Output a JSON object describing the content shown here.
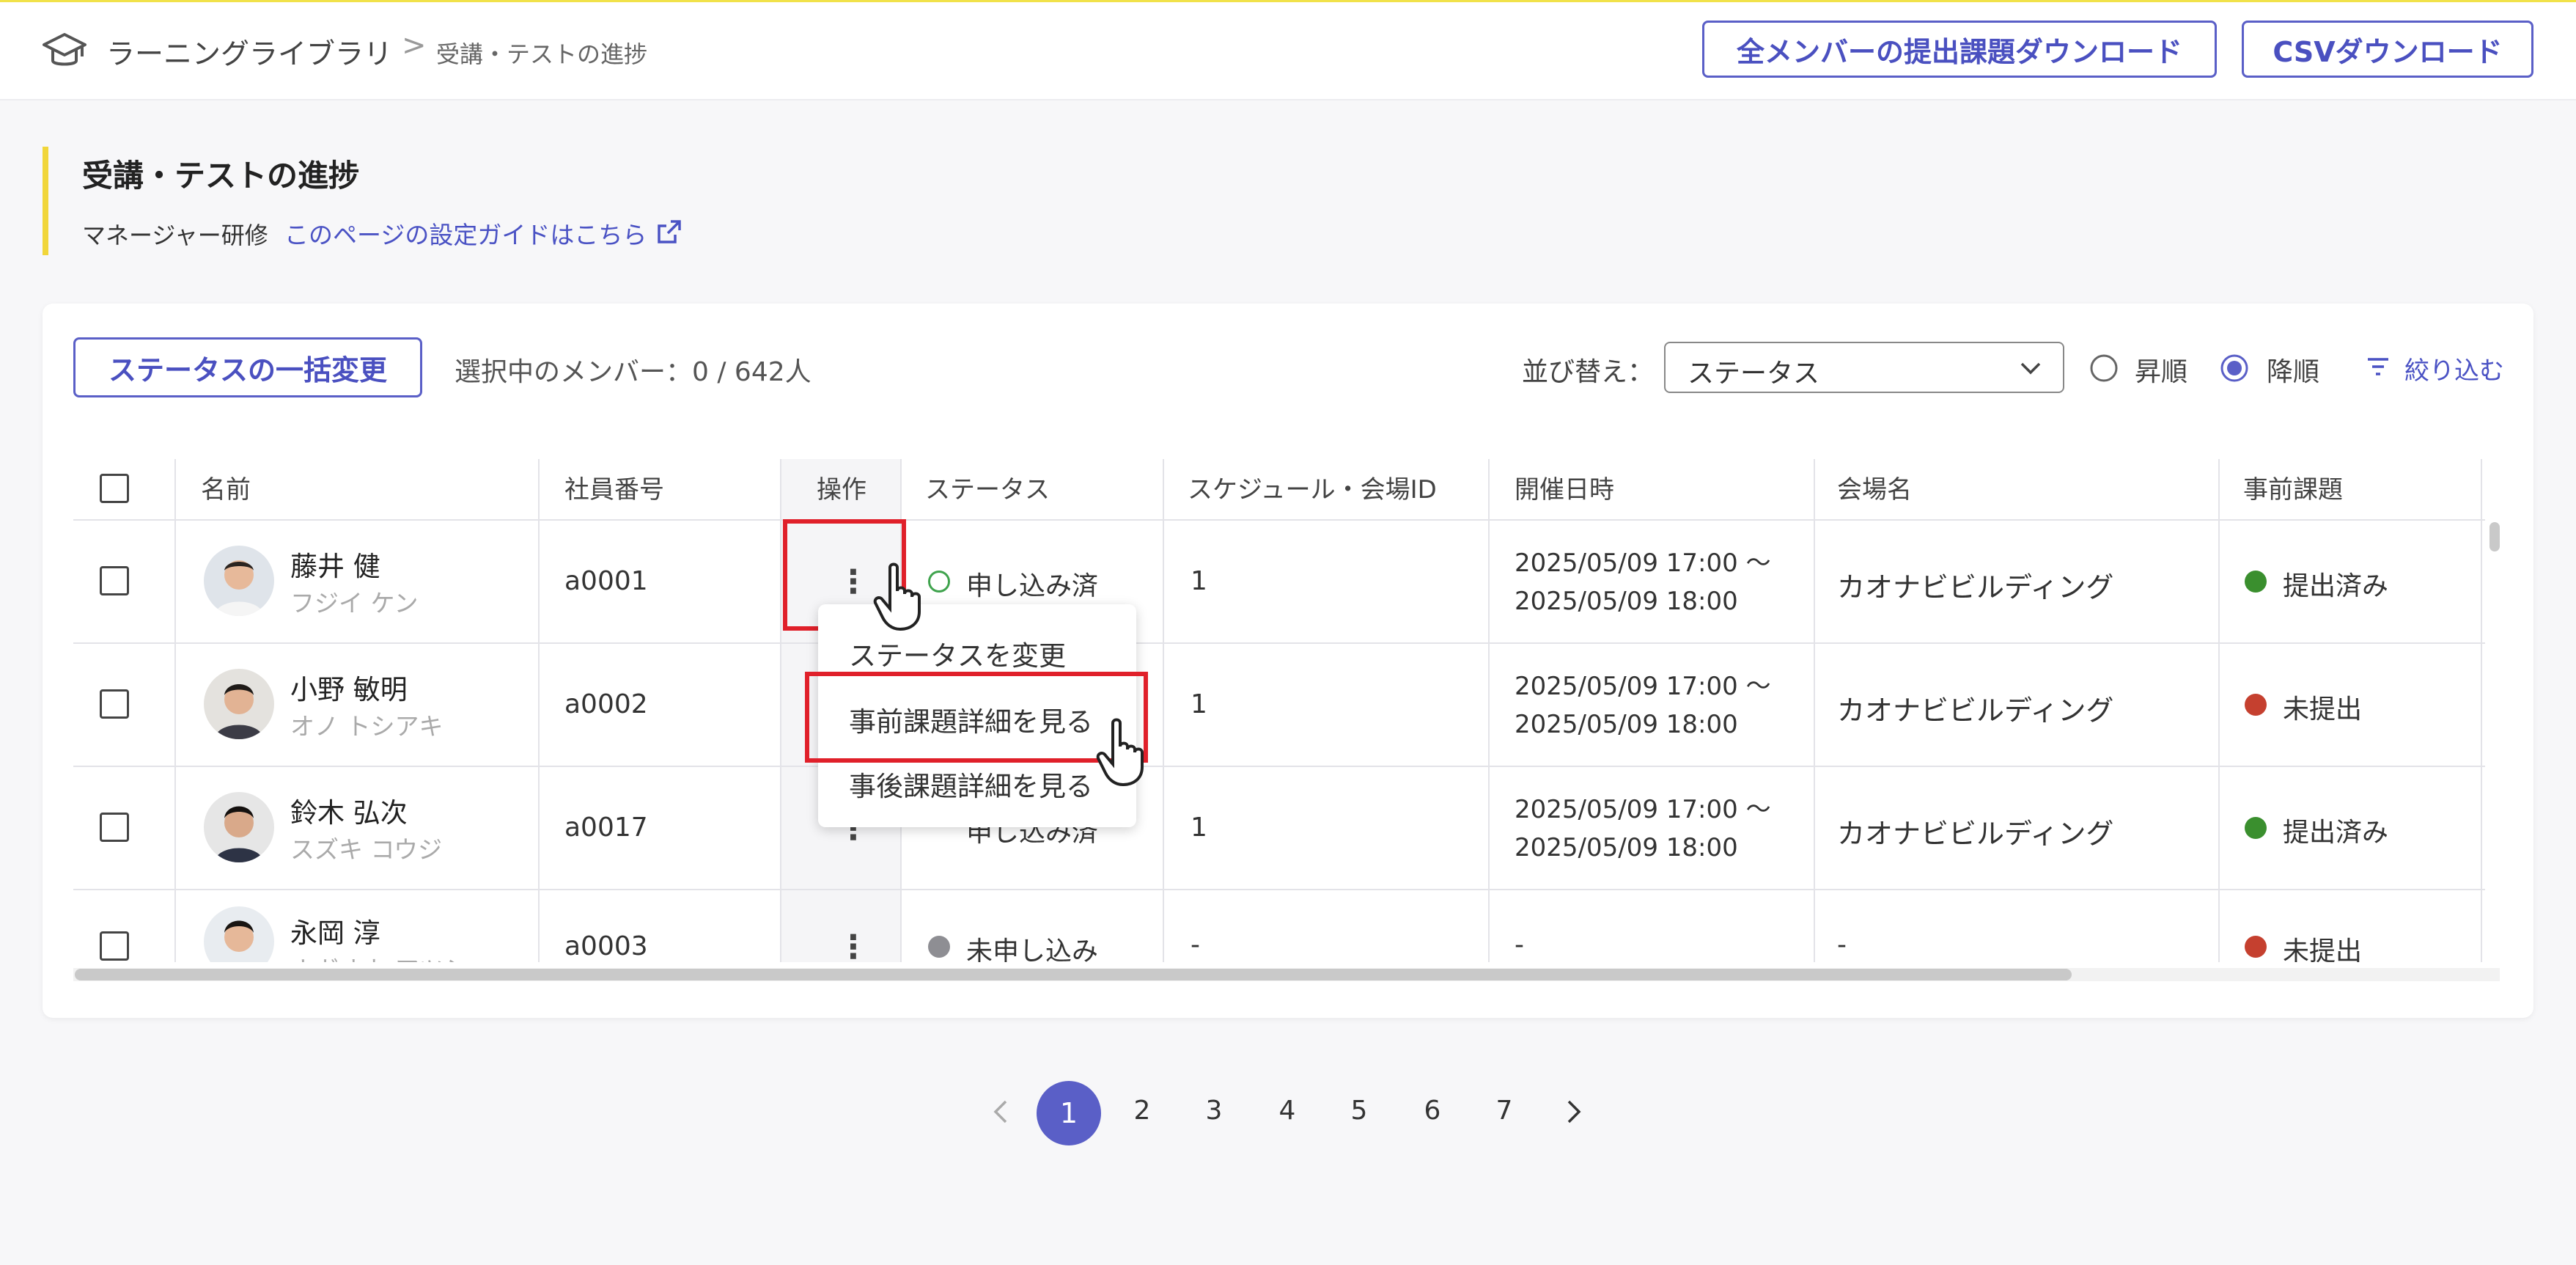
{
  "header": {
    "breadcrumb_root": "ラーニングライブラリ",
    "breadcrumb_sep": ">",
    "breadcrumb_current": "受講・テストの進捗",
    "download_all_label": "全メンバーの提出課題ダウンロード",
    "csv_label": "CSVダウンロード"
  },
  "page": {
    "title": "受講・テストの進捗",
    "course_name": "マネージャー研修",
    "guide_link": "このページの設定ガイドはこちら"
  },
  "toolbar": {
    "bulk_label": "ステータスの一括変更",
    "selected_text": "選択中のメンバー：0 / 642人",
    "sort_label": "並び替え：",
    "sort_value": "ステータス",
    "asc_label": "昇順",
    "desc_label": "降順",
    "sort_order_selected": "降順",
    "filter_label": "絞り込む"
  },
  "table": {
    "columns": [
      "名前",
      "社員番号",
      "操作",
      "ステータス",
      "スケジュール・会場ID",
      "開催日時",
      "会場名",
      "事前課題"
    ],
    "rows": [
      {
        "name": "藤井 健",
        "kana": "フジイ ケン",
        "emp_no": "a0001",
        "status": "申し込み済",
        "schedule_id": "1",
        "date_start": "2025/05/09 17:00 〜",
        "date_end": "2025/05/09 18:00",
        "venue": "カオナビビルディング",
        "pre_task": "提出済み"
      },
      {
        "name": "小野 敏明",
        "kana": "オノ トシアキ",
        "emp_no": "a0002",
        "status": "",
        "schedule_id": "1",
        "date_start": "2025/05/09 17:00 〜",
        "date_end": "2025/05/09 18:00",
        "venue": "カオナビビルディング",
        "pre_task": "未提出"
      },
      {
        "name": "鈴木 弘次",
        "kana": "スズキ コウジ",
        "emp_no": "a0017",
        "status": "申し込み済",
        "schedule_id": "1",
        "date_start": "2025/05/09 17:00 〜",
        "date_end": "2025/05/09 18:00",
        "venue": "カオナビビルディング",
        "pre_task": "提出済み"
      },
      {
        "name": "永岡 淳",
        "kana": "ナガオカ アツシ",
        "emp_no": "a0003",
        "status": "未申し込み",
        "schedule_id": "-",
        "date_start": "-",
        "date_end": "",
        "venue": "-",
        "pre_task": "未提出"
      }
    ],
    "action_glyph": "⋮"
  },
  "context_menu": {
    "items": [
      "ステータスを変更",
      "事前課題詳細を見る",
      "事後課題詳細を見る"
    ]
  },
  "pagination": {
    "pages": [
      "1",
      "2",
      "3",
      "4",
      "5",
      "6",
      "7"
    ],
    "current": "1"
  },
  "colors": {
    "accent": "#5a5fc7",
    "link": "#4a52c4",
    "highlight": "#e0202a",
    "submitted": "#3a8f2e",
    "not_submitted": "#c5402f",
    "applied_ring": "#3fa34d",
    "not_applied": "#8e8e93",
    "title_bar": "#f1d63a"
  }
}
